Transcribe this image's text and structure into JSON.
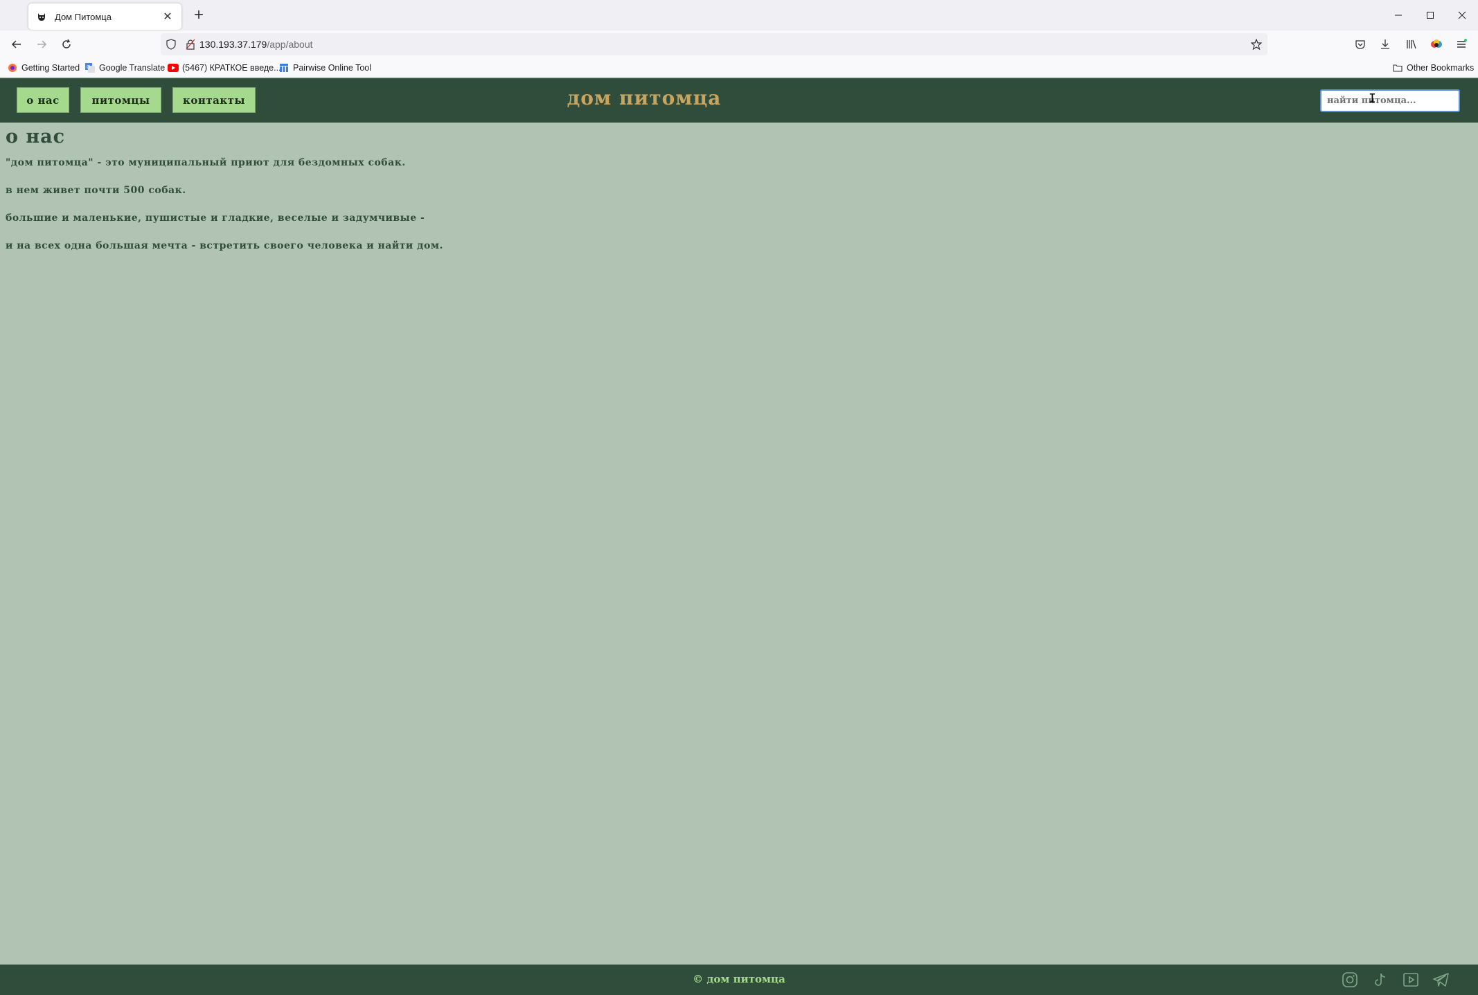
{
  "browser": {
    "tab_title": "Дом Питомца",
    "new_tab": "+",
    "url_host": "130.193.37.179",
    "url_path": "/app/about",
    "bookmarks": [
      {
        "label": "Getting Started",
        "icon": "firefox-icon"
      },
      {
        "label": "Google Translate",
        "icon": "google-translate-icon"
      },
      {
        "label": "(5467) КРАТКОЕ введе...",
        "icon": "youtube-icon"
      },
      {
        "label": "Pairwise Online Tool",
        "icon": "grid-icon"
      }
    ],
    "other_bookmarks": "Other Bookmarks"
  },
  "site": {
    "nav": [
      "о нас",
      "питомцы",
      "контакты"
    ],
    "logo": "дом питомца",
    "search_placeholder": "найти питомца...",
    "page_title": "о нас",
    "paragraphs": [
      "\"дом питомца\" - это муниципальный приют для бездомных собак.",
      "в нем живет почти 500 собак.",
      "большие и маленькие, пушистые и гладкие, веселые и задумчивые -",
      "и на всех одна большая мечта - встретить своего человека и найти дом."
    ],
    "footer": "© дом питомца",
    "social": [
      "instagram-icon",
      "tiktok-icon",
      "youtube-icon",
      "telegram-icon"
    ]
  },
  "colors": {
    "header_bg": "#2f4d3a",
    "page_bg": "#b1c3b3",
    "nav_button_bg": "#a5d98e",
    "logo": "#c8a45e",
    "text": "#2f4d3a"
  }
}
